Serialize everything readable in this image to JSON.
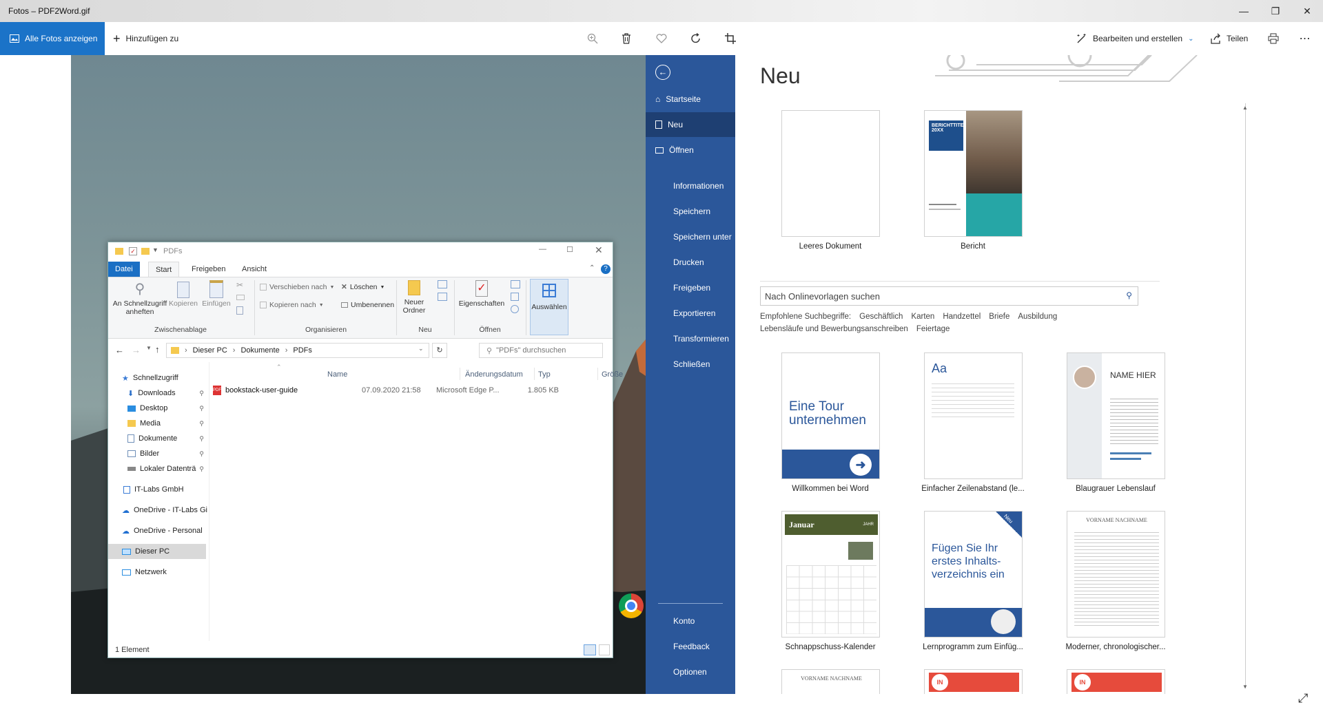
{
  "window": {
    "title": "Fotos – PDF2Word.gif"
  },
  "toolbar": {
    "all_photos": "Alle Fotos anzeigen",
    "add_to": "Hinzufügen zu",
    "icons": [
      "zoom-icon",
      "delete-icon",
      "favorite-icon",
      "rotate-icon",
      "crop-icon"
    ],
    "edit_create": "Bearbeiten und erstellen",
    "share": "Teilen"
  },
  "explorer": {
    "title": "PDFs",
    "tabs": [
      "Datei",
      "Start",
      "Freigeben",
      "Ansicht"
    ],
    "ribbon": {
      "pin_line1": "An Schnellzugriff",
      "pin_line2": "anheften",
      "copy": "Kopieren",
      "paste": "Einfügen",
      "clipboard_group": "Zwischenablage",
      "move_to": "Verschieben nach",
      "copy_to": "Kopieren nach",
      "delete": "Löschen",
      "rename": "Umbenennen",
      "organize_group": "Organisieren",
      "new_folder_line1": "Neuer",
      "new_folder_line2": "Ordner",
      "new_group": "Neu",
      "properties": "Eigenschaften",
      "open_group": "Öffnen",
      "select": "Auswählen"
    },
    "breadcrumb": [
      "Dieser PC",
      "Dokumente",
      "PDFs"
    ],
    "search_placeholder": "\"PDFs\" durchsuchen",
    "nav": [
      {
        "label": "Schnellzugriff"
      },
      {
        "label": "Downloads"
      },
      {
        "label": "Desktop"
      },
      {
        "label": "Media"
      },
      {
        "label": "Dokumente"
      },
      {
        "label": "Bilder"
      },
      {
        "label": "Lokaler Datenträ"
      },
      {
        "label": "IT-Labs GmbH"
      },
      {
        "label": "OneDrive - IT-Labs Gi"
      },
      {
        "label": "OneDrive - Personal"
      },
      {
        "label": "Dieser PC"
      },
      {
        "label": "Netzwerk"
      }
    ],
    "columns": [
      "Name",
      "Änderungsdatum",
      "Typ",
      "Größe"
    ],
    "files": [
      {
        "name": "bookstack-user-guide",
        "date": "07.09.2020 21:58",
        "type": "Microsoft Edge P...",
        "size": "1.805 KB"
      }
    ],
    "status": "1 Element"
  },
  "word": {
    "sidebar": {
      "items": [
        "Startseite",
        "Neu",
        "Öffnen",
        "Informationen",
        "Speichern",
        "Speichern unter",
        "Drucken",
        "Freigeben",
        "Exportieren",
        "Transformieren",
        "Schließen"
      ],
      "bottom": [
        "Konto",
        "Feedback",
        "Optionen"
      ]
    },
    "heading": "Neu",
    "top_templates": [
      "Leeres Dokument",
      "Bericht"
    ],
    "report_cover": "BERICHTTITEL 20XX",
    "search_placeholder": "Nach Onlinevorlagen suchen",
    "suggested_label": "Empfohlene Suchbegriffe:",
    "keywords": [
      "Geschäftlich",
      "Karten",
      "Handzettel",
      "Briefe",
      "Ausbildung"
    ],
    "keywords2": [
      "Lebensläufe und Bewerbungsanschreiben",
      "Feiertage"
    ],
    "templates": [
      "Willkommen bei Word",
      "Einfacher Zeilenabstand (le...",
      "Blaugrauer Lebenslauf",
      "Schnappschuss-Kalender",
      "Lernprogramm zum Einfüg...",
      "Moderner, chronologischer..."
    ],
    "tour_text": "Eine Tour unternehmen",
    "toc_text": "Fügen Sie Ihr erstes Inhalts-verzeichnis ein",
    "resume_name": "NAME HIER",
    "calendar_month": "Januar",
    "calendar_year": "JAHR",
    "new_badge": "Neu",
    "vorname": "VORNAME NACHNAME",
    "aa": "Aa",
    "in_badge": "IN"
  }
}
